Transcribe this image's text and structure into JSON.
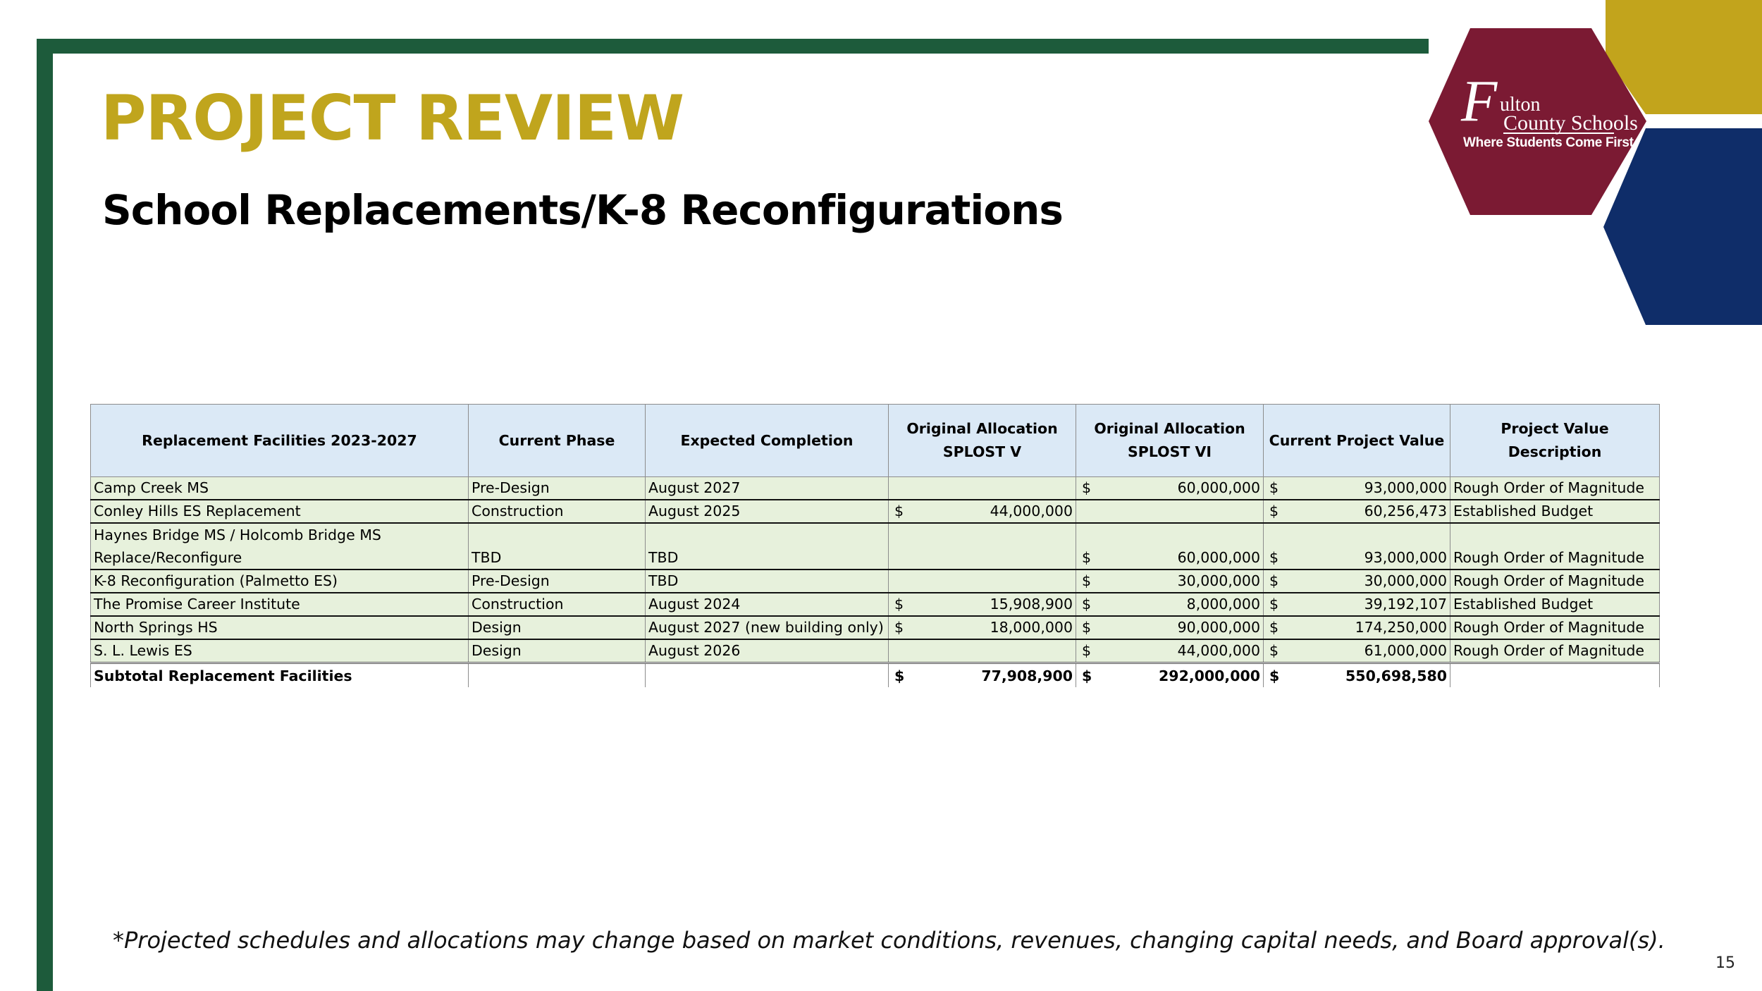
{
  "slide": {
    "title": "PROJECT REVIEW",
    "subtitle": "School Replacements/K-8 Reconfigurations",
    "page_number": "15",
    "footnote": "*Projected schedules and allocations may change based on market conditions, revenues, changing capital needs, and Board approval(s)."
  },
  "logo": {
    "letter": "F",
    "line1": "ulton",
    "line2": "County Schools",
    "tagline": "Where Students Come First"
  },
  "colors": {
    "frame_green": "#1d5b3b",
    "title_gold": "#c0a51d",
    "logo_maroon": "#7b1a33",
    "hex_gold": "#c2a41c",
    "hex_navy": "#0f2d69",
    "header_blue": "#dbe9f6",
    "row_green": "#e7f1dc"
  },
  "table": {
    "headers": {
      "facility": "Replacement Facilities 2023-2027",
      "phase": "Current Phase",
      "completion": "Expected Completion",
      "splost5_l1": "Original Allocation",
      "splost5_l2": "SPLOST V",
      "splost6_l1": "Original Allocation",
      "splost6_l2": "SPLOST VI",
      "value": "Current Project Value",
      "description": "Project Value Description"
    },
    "rows": [
      {
        "facility": "Camp Creek MS",
        "phase": "Pre-Design",
        "completion": "August 2027",
        "splost5_cur": "",
        "splost5": "",
        "splost6_cur": "$",
        "splost6": "60,000,000",
        "value_cur": "$",
        "value": "93,000,000",
        "description": "Rough Order of Magnitude"
      },
      {
        "facility": "Conley Hills ES Replacement",
        "phase": "Construction",
        "completion": "August 2025",
        "splost5_cur": "$",
        "splost5": "44,000,000",
        "splost6_cur": "",
        "splost6": "",
        "value_cur": "$",
        "value": "60,256,473",
        "description": "Established Budget"
      },
      {
        "facility": "Haynes Bridge MS / Holcomb Bridge MS Replace/Reconfigure",
        "phase": "TBD",
        "completion": "TBD",
        "splost5_cur": "",
        "splost5": "",
        "splost6_cur": "$",
        "splost6": "60,000,000",
        "value_cur": "$",
        "value": "93,000,000",
        "description": "Rough Order of Magnitude"
      },
      {
        "facility": "K-8 Reconfiguration (Palmetto ES)",
        "phase": "Pre-Design",
        "completion": "TBD",
        "splost5_cur": "",
        "splost5": "",
        "splost6_cur": "$",
        "splost6": "30,000,000",
        "value_cur": "$",
        "value": "30,000,000",
        "description": "Rough Order of Magnitude"
      },
      {
        "facility": "The Promise Career Institute",
        "phase": "Construction",
        "completion": "August 2024",
        "splost5_cur": "$",
        "splost5": "15,908,900",
        "splost6_cur": "$",
        "splost6": "8,000,000",
        "value_cur": "$",
        "value": "39,192,107",
        "description": "Established Budget"
      },
      {
        "facility": "North Springs HS",
        "phase": "Design",
        "completion": "August 2027 (new building only)",
        "splost5_cur": "$",
        "splost5": "18,000,000",
        "splost6_cur": "$",
        "splost6": "90,000,000",
        "value_cur": "$",
        "value": "174,250,000",
        "description": "Rough Order of Magnitude"
      },
      {
        "facility": "S. L. Lewis ES",
        "phase": "Design",
        "completion": "August 2026",
        "splost5_cur": "",
        "splost5": "",
        "splost6_cur": "$",
        "splost6": "44,000,000",
        "value_cur": "$",
        "value": "61,000,000",
        "description": "Rough Order of Magnitude"
      }
    ],
    "total": {
      "facility": "Subtotal Replacement Facilities",
      "phase": "",
      "completion": "",
      "splost5_cur": "$",
      "splost5": "77,908,900",
      "splost6_cur": "$",
      "splost6": "292,000,000",
      "value_cur": "$",
      "value": "550,698,580",
      "description": ""
    }
  }
}
